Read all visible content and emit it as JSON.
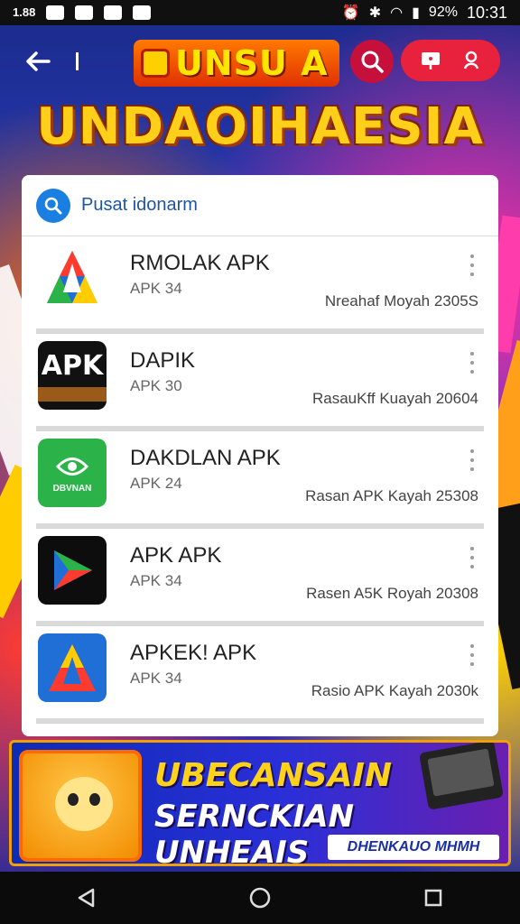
{
  "status_bar": {
    "carrier_text": "1.88",
    "time": "10:31",
    "battery": "92%"
  },
  "header": {
    "brand_text": "UNSU A",
    "page_title": "UNDAOIHAESIA",
    "back_icon": "arrow-left-icon",
    "search_icon": "search-icon"
  },
  "search": {
    "placeholder": "Pusat idonarm"
  },
  "apps": [
    {
      "name": "RMOLAK APK",
      "version": "APK 34",
      "meta": "Nreahaf Moyah 2305S",
      "icon_bg": "#ffffff",
      "icon_text": ""
    },
    {
      "name": "DAPIK",
      "version": "APK 30",
      "meta": "RasauKff Kuayah 20604",
      "icon_bg": "#111111",
      "icon_text": "APK"
    },
    {
      "name": "DAKDLAN APK",
      "version": "APK 24",
      "meta": "Rasan APK Kayah 25308",
      "icon_bg": "#2bb34a",
      "icon_text": "DBVNAN"
    },
    {
      "name": "APK APK",
      "version": "APK 34",
      "meta": "Rasen A5K Royah 20308",
      "icon_bg": "#0d0d0d",
      "icon_text": ""
    },
    {
      "name": "APKEK! APK",
      "version": "APK 34",
      "meta": "Rasio APK Kayah 2030k",
      "icon_bg": "#1f6fd6",
      "icon_text": ""
    }
  ],
  "banner": {
    "title": "UBECANSAIN",
    "subtitle": "SERNCKIAN UNHEAIS",
    "cta": "DHENKAUO MHMH"
  },
  "colors": {
    "accent": "#e8213d",
    "title_gold": "#ffcf1a",
    "search_blue": "#1a7fe0"
  }
}
